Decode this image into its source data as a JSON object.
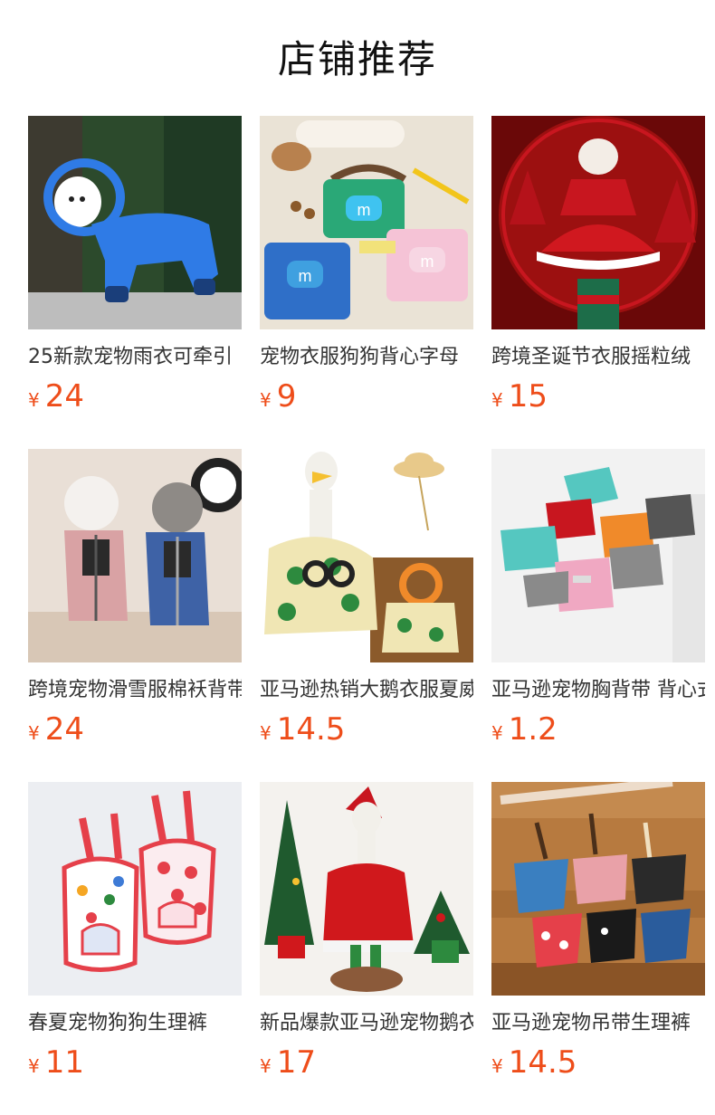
{
  "page": {
    "title": "店铺推荐"
  },
  "products": [
    {
      "name": "25新款宠物雨衣可牵引",
      "currency": "¥",
      "price": "24",
      "icon": "dog-raincoat-image",
      "colors": {
        "bg1": "#2c4a2c",
        "bg2": "#bdbdbd",
        "main": "#2f7be6",
        "accent": "#ffffff"
      }
    },
    {
      "name": "宠物衣服狗狗背心字母",
      "currency": "¥",
      "price": "9",
      "icon": "dog-vest-image",
      "colors": {
        "bg1": "#eae3d6",
        "bg2": "#e9e1d3",
        "main": "#2aa877",
        "accent": "#f5c3d6"
      }
    },
    {
      "name": "跨境圣诞节衣服摇粒绒",
      "currency": "¥",
      "price": "15",
      "icon": "christmas-dress-image",
      "colors": {
        "bg1": "#9c1010",
        "bg2": "#6a0808",
        "main": "#c8161f",
        "accent": "#ffffff"
      }
    },
    {
      "name": "跨境宠物滑雪服棉袄背带",
      "currency": "¥",
      "price": "24",
      "icon": "ski-jacket-image",
      "colors": {
        "bg1": "#e9dfd6",
        "bg2": "#d8c7b6",
        "main": "#d9a2a4",
        "accent": "#3e62a6"
      }
    },
    {
      "name": "亚马逊热销大鹅衣服夏威夷",
      "currency": "¥",
      "price": "14.5",
      "icon": "goose-hawaiian-outfit-image",
      "colors": {
        "bg1": "#ffffff",
        "bg2": "#8b5a2b",
        "main": "#f0e6b4",
        "accent": "#2d8a3e"
      }
    },
    {
      "name": "亚马逊宠物胸背带 背心式",
      "currency": "¥",
      "price": "1.2",
      "icon": "pet-harness-image",
      "colors": {
        "bg1": "#f2f2f2",
        "bg2": "#e6e6e6",
        "main": "#55c7c0",
        "accent": "#f08a2a"
      }
    },
    {
      "name": "春夏宠物狗狗生理裤",
      "currency": "¥",
      "price": "11",
      "icon": "dog-diaper-image",
      "colors": {
        "bg1": "#eceef2",
        "bg2": "#dfe2e8",
        "main": "#e5404a",
        "accent": "#ffffff"
      }
    },
    {
      "name": "新品爆款亚马逊宠物鹅衣服",
      "currency": "¥",
      "price": "17",
      "icon": "goose-santa-outfit-image",
      "colors": {
        "bg1": "#f4f2ee",
        "bg2": "#1f5a2e",
        "main": "#d0181c",
        "accent": "#f5f5f5"
      }
    },
    {
      "name": "亚马逊宠物吊带生理裤",
      "currency": "¥",
      "price": "14.5",
      "icon": "suspender-diaper-image",
      "colors": {
        "bg1": "#b77a3f",
        "bg2": "#8a5426",
        "main": "#3a7fc0",
        "accent": "#e9a1a8"
      }
    }
  ]
}
